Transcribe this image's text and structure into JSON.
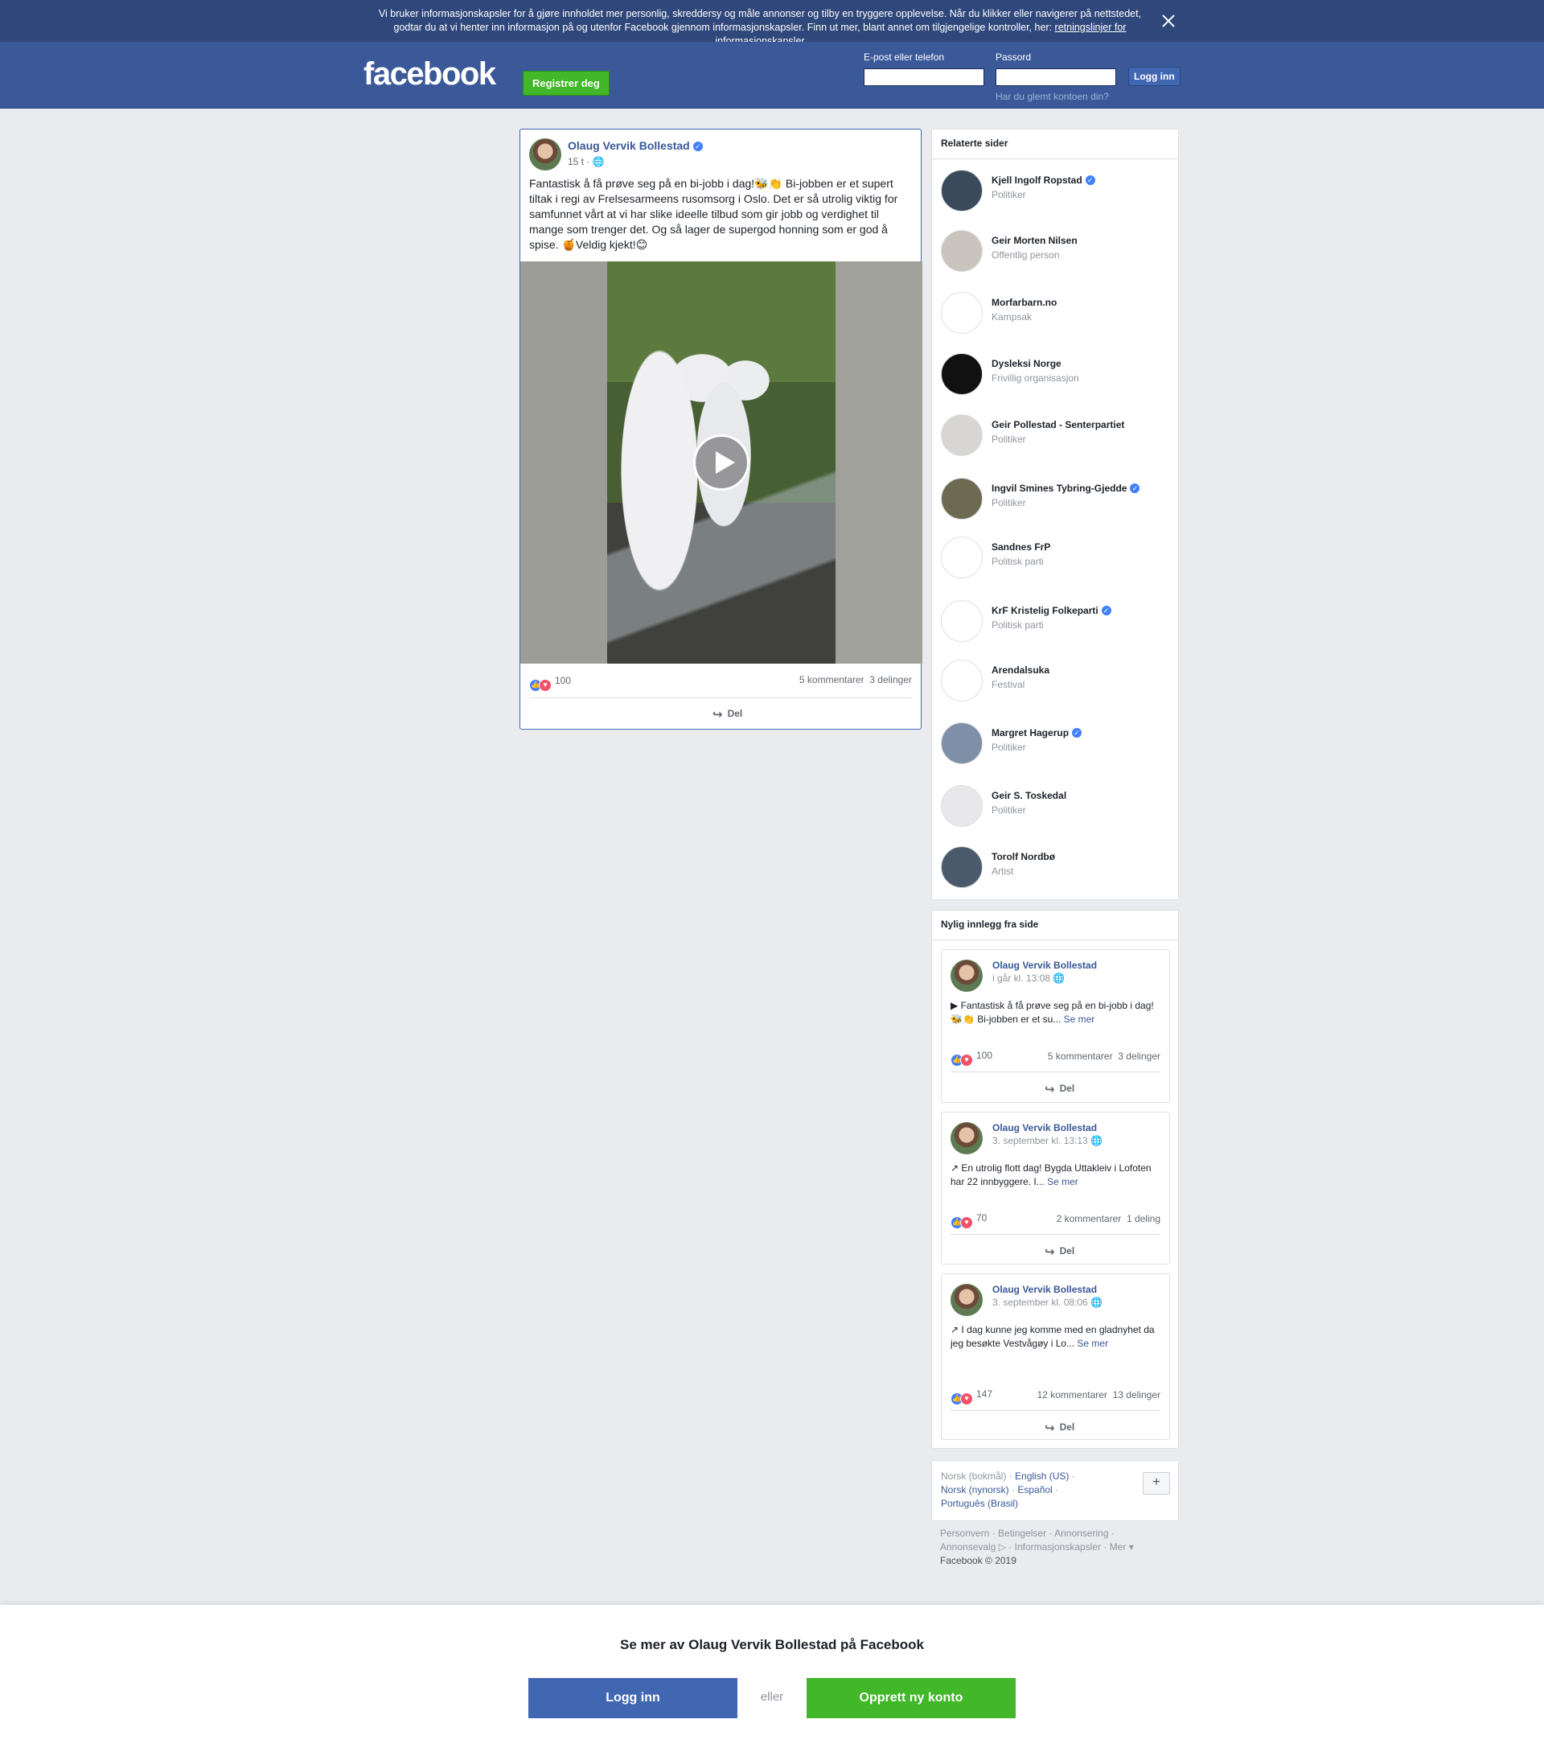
{
  "cookie": {
    "text": "Vi bruker informasjonskapsler for å gjøre innholdet mer personlig, skreddersy og måle annonser og tilby en tryggere opplevelse. Når du klikker eller navigerer på nettstedet, godtar du at vi henter inn informasjon på og utenfor Facebook gjennom informasjonskapsler. Finn ut mer, blant annet om tilgjengelige kontroller, her: ",
    "link": "retningslinjer for informasjonskapsler"
  },
  "header": {
    "logo": "facebook",
    "register": "Registrer deg",
    "email_label": "E-post eller telefon",
    "password_label": "Passord",
    "login": "Logg inn",
    "forgot": "Har du glemt kontoen din?"
  },
  "post": {
    "author": "Olaug Vervik Bollestad",
    "time": "15 t · ",
    "text": "Fantastisk å få prøve seg på en bi-jobb i dag!🐝👏 Bi-jobben er et supert tiltak i regi av Frelsesarmeens rusomsorg i Oslo. Det er så utrolig viktig for samfunnet vårt at vi har slike ideelle tilbud som gir jobb og verdighet til mange som trenger det. Og så lager de supergod honning som er god å spise. 🍯Veldig kjekt!😊",
    "reactions": "100",
    "comments": "5 kommentarer",
    "shares": "3 delinger",
    "share_label": "Del"
  },
  "related": {
    "title": "Relaterte sider",
    "items": [
      {
        "name": "Kjell Ingolf Ropstad",
        "type": "Politiker",
        "verified": true,
        "color": "#3a4a5a"
      },
      {
        "name": "Geir Morten Nilsen",
        "type": "Offentlig person",
        "verified": false,
        "color": "#c9c5be"
      },
      {
        "name": "Morfarbarn.no",
        "type": "Kampsak",
        "verified": false,
        "color": "#ffffff"
      },
      {
        "name": "Dysleksi Norge",
        "type": "Frivillig organisasjon",
        "verified": false,
        "color": "#111111"
      },
      {
        "name": "Geir Pollestad - Senterpartiet",
        "type": "Politiker",
        "verified": false,
        "color": "#d8d6d3"
      },
      {
        "name": "Ingvil Smines Tybring-Gjedde",
        "type": "Politiker",
        "verified": true,
        "color": "#6d6a52"
      },
      {
        "name": "Sandnes FrP",
        "type": "Politisk parti",
        "verified": false,
        "color": "#ffffff"
      },
      {
        "name": "KrF Kristelig Folkeparti",
        "type": "Politisk parti",
        "verified": true,
        "color": "#ffffff"
      },
      {
        "name": "Arendalsuka",
        "type": "Festival",
        "verified": false,
        "color": "#ffffff"
      },
      {
        "name": "Margret Hagerup",
        "type": "Politiker",
        "verified": true,
        "color": "#7f8fa8"
      },
      {
        "name": "Geir S. Toskedal",
        "type": "Politiker",
        "verified": false,
        "color": "#e8e8ea"
      },
      {
        "name": "Torolf Nordbø",
        "type": "Artist",
        "verified": false,
        "color": "#4a5a6a"
      }
    ]
  },
  "recent": {
    "title": "Nylig innlegg fra side",
    "items": [
      {
        "author": "Olaug Vervik Bollestad",
        "time": "i går kl. 13:08",
        "text": "Fantastisk å få prøve seg på en bi-jobb i dag!🐝👏 Bi-jobben er et su...",
        "more": "Se mer",
        "icon": "video-icon",
        "reactions": "100",
        "comments": "5 kommentarer",
        "shares": "3 delinger"
      },
      {
        "author": "Olaug Vervik Bollestad",
        "time": "3. september kl. 13:13",
        "text": "En utrolig flott dag! Bygda Uttakleiv i Lofoten har 22 innbyggere. I...",
        "more": "Se mer",
        "icon": "link-icon",
        "reactions": "70",
        "comments": "2 kommentarer",
        "shares": "1 deling"
      },
      {
        "author": "Olaug Vervik Bollestad",
        "time": "3. september kl. 08:06",
        "text": "I dag kunne jeg komme med en gladnyhet da jeg besøkte Vestvågøy i Lo...",
        "more": "Se mer",
        "icon": "link-icon",
        "reactions": "147",
        "comments": "12 kommentarer",
        "shares": "13 delinger"
      }
    ],
    "share_label": "Del"
  },
  "languages": {
    "current": "Norsk (bokmål)",
    "others": [
      "English (US)",
      "Norsk (nynorsk)",
      "Español",
      "Português (Brasil)"
    ],
    "plus": "+"
  },
  "footer": {
    "links": [
      "Personvern",
      "Betingelser",
      "Annonsering",
      "Annonsevalg ▷",
      "Informasjonskapsler",
      "Mer ▾"
    ],
    "copyright": "Facebook © 2019"
  },
  "bottom": {
    "title": "Se mer av Olaug Vervik Bollestad på Facebook",
    "login": "Logg inn",
    "or": "eller",
    "create": "Opprett ny konto"
  }
}
